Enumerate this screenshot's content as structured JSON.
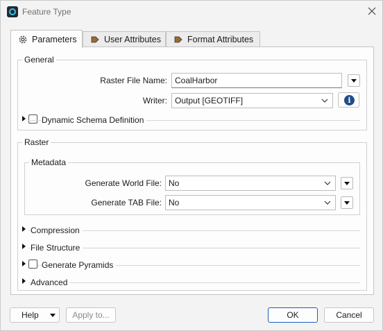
{
  "window": {
    "title": "Feature Type"
  },
  "tabs": [
    {
      "label": "Parameters",
      "icon": "gear-icon",
      "active": true
    },
    {
      "label": "User Attributes",
      "icon": "arrow-tag-icon",
      "active": false
    },
    {
      "label": "Format Attributes",
      "icon": "arrow-tag-icon",
      "active": false
    }
  ],
  "general": {
    "title": "General",
    "raster_file_name_label": "Raster File Name:",
    "raster_file_name_value": "CoalHarbor",
    "writer_label": "Writer:",
    "writer_value": "Output [GEOTIFF]",
    "dynamic_schema_label": "Dynamic Schema Definition",
    "dynamic_schema_checked": false
  },
  "raster": {
    "title": "Raster",
    "metadata": {
      "title": "Metadata",
      "world_file_label": "Generate World File:",
      "world_file_value": "No",
      "tab_file_label": "Generate TAB File:",
      "tab_file_value": "No"
    },
    "sections": {
      "compression": "Compression",
      "file_structure": "File Structure",
      "generate_pyramids": "Generate Pyramids",
      "advanced": "Advanced"
    },
    "generate_pyramids_checked": false
  },
  "buttons": {
    "help": "Help",
    "apply_to": "Apply to...",
    "ok": "OK",
    "cancel": "Cancel"
  },
  "colors": {
    "accent": "#1a5fb4",
    "info": "#1f4d89",
    "app_icon_ring": "#36c3e6"
  }
}
